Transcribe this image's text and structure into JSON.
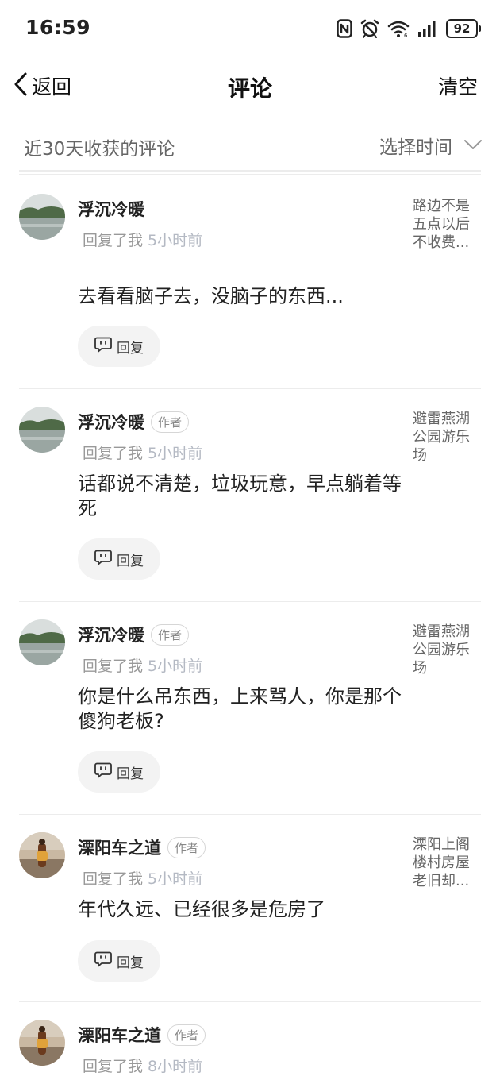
{
  "status_bar": {
    "time": "16:59",
    "battery": "92",
    "icons": [
      "nfc-icon",
      "alarm-icon",
      "wifi-icon",
      "signal-icon",
      "battery-icon"
    ]
  },
  "header": {
    "back_label": "返回",
    "title": "评论",
    "clear_label": "清空"
  },
  "filter": {
    "label": "近30天收获的评论",
    "select_label": "选择时间"
  },
  "comments": [
    {
      "name": "浮沉冷暖",
      "badge": "",
      "action": "回复了我",
      "time": "5小时前",
      "text": "去看看脑子去，没脑子的东西...",
      "ref": "路边不是五点以后不收费...",
      "reply_label": "回复",
      "avatar": "lake"
    },
    {
      "name": "浮沉冷暖",
      "badge": "作者",
      "action": "回复了我",
      "time": "5小时前",
      "text": "话都说不清楚，垃圾玩意，早点躺着等死",
      "ref": "避雷燕湖公园游乐场",
      "reply_label": "回复",
      "avatar": "lake"
    },
    {
      "name": "浮沉冷暖",
      "badge": "作者",
      "action": "回复了我",
      "time": "5小时前",
      "text": "你是什么吊东西，上来骂人，你是那个傻狗老板?",
      "ref": "避雷燕湖公园游乐场",
      "reply_label": "回复",
      "avatar": "lake"
    },
    {
      "name": "溧阳车之道",
      "badge": "作者",
      "action": "回复了我",
      "time": "5小时前",
      "text": "年代久远、已经很多是危房了",
      "ref": "溧阳上阁楼村房屋老旧却...",
      "reply_label": "回复",
      "avatar": "person"
    },
    {
      "name": "溧阳车之道",
      "badge": "作者",
      "action": "回复了我",
      "time": "8小时前",
      "avatar": "person"
    }
  ],
  "colors": {
    "primary_text": "#222222",
    "secondary_text": "#666666",
    "time_text": "#b4b9c3",
    "reply_bg": "#f3f3f3",
    "divider": "#ececec"
  }
}
